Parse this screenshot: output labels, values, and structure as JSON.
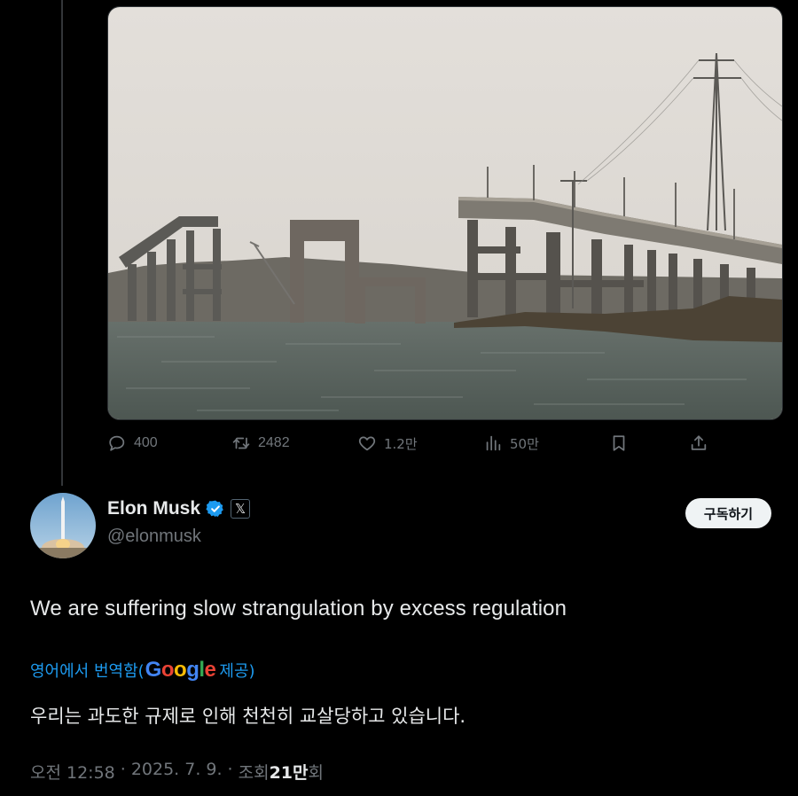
{
  "previous_tweet": {
    "media_description_icon": "photo",
    "actions": {
      "reply_count": "400",
      "retweet_count": "2482",
      "like_count": "1.2만",
      "view_count": "50만"
    }
  },
  "tweet": {
    "author_name": "Elon Musk",
    "author_handle": "@elonmusk",
    "subscribe_label": "구독하기",
    "text": "We are suffering slow strangulation by excess regulation",
    "translate_prefix": "영어에서 번역함(",
    "translate_provider": "Google",
    "translate_suffix": " 제공)",
    "translated_text": "우리는 과도한 규제로 인해 천천히 교살당하고 있습니다.",
    "time": "오전 12:58",
    "date": "2025. 7. 9.",
    "views_label": "조회",
    "views_count": "21만",
    "views_unit": "회"
  },
  "colors": {
    "accent": "#1d9bf0",
    "muted": "#71767b",
    "text": "#e7e9ea",
    "background": "#000000"
  }
}
